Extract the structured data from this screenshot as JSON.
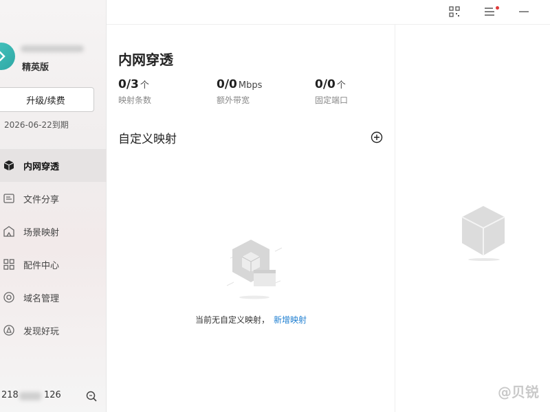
{
  "sidebar": {
    "edition": "精英版",
    "upgrade_label": "升级/续费",
    "expire_text": "2026-06-22到期",
    "items": [
      {
        "label": "内网穿透",
        "icon": "cube-icon",
        "active": true
      },
      {
        "label": "文件分享",
        "icon": "file-share-icon",
        "active": false
      },
      {
        "label": "场景映射",
        "icon": "scene-map-icon",
        "active": false
      },
      {
        "label": "配件中心",
        "icon": "grid-icon",
        "active": false
      },
      {
        "label": "域名管理",
        "icon": "domain-icon",
        "active": false
      },
      {
        "label": "发现好玩",
        "icon": "discover-icon",
        "active": false
      }
    ],
    "ip_prefix": "218",
    "ip_suffix": "126"
  },
  "topbar": {
    "icons": [
      "qrcode-icon",
      "menu-icon",
      "minimize-icon"
    ],
    "notification_color": "#e03a3a"
  },
  "main": {
    "title": "内网穿透",
    "stats": [
      {
        "value": "0/3",
        "unit": "个",
        "label": "映射条数"
      },
      {
        "value": "0/0",
        "unit": "Mbps",
        "label": "额外带宽"
      },
      {
        "value": "0/0",
        "unit": "个",
        "label": "固定端口"
      }
    ],
    "section_title": "自定义映射",
    "empty_text": "当前无自定义映射，",
    "empty_link": "新增映射"
  },
  "right": {
    "watermark": "@贝锐"
  },
  "colors": {
    "accent": "#1f7fd1",
    "logo": "#3bb7b3"
  }
}
